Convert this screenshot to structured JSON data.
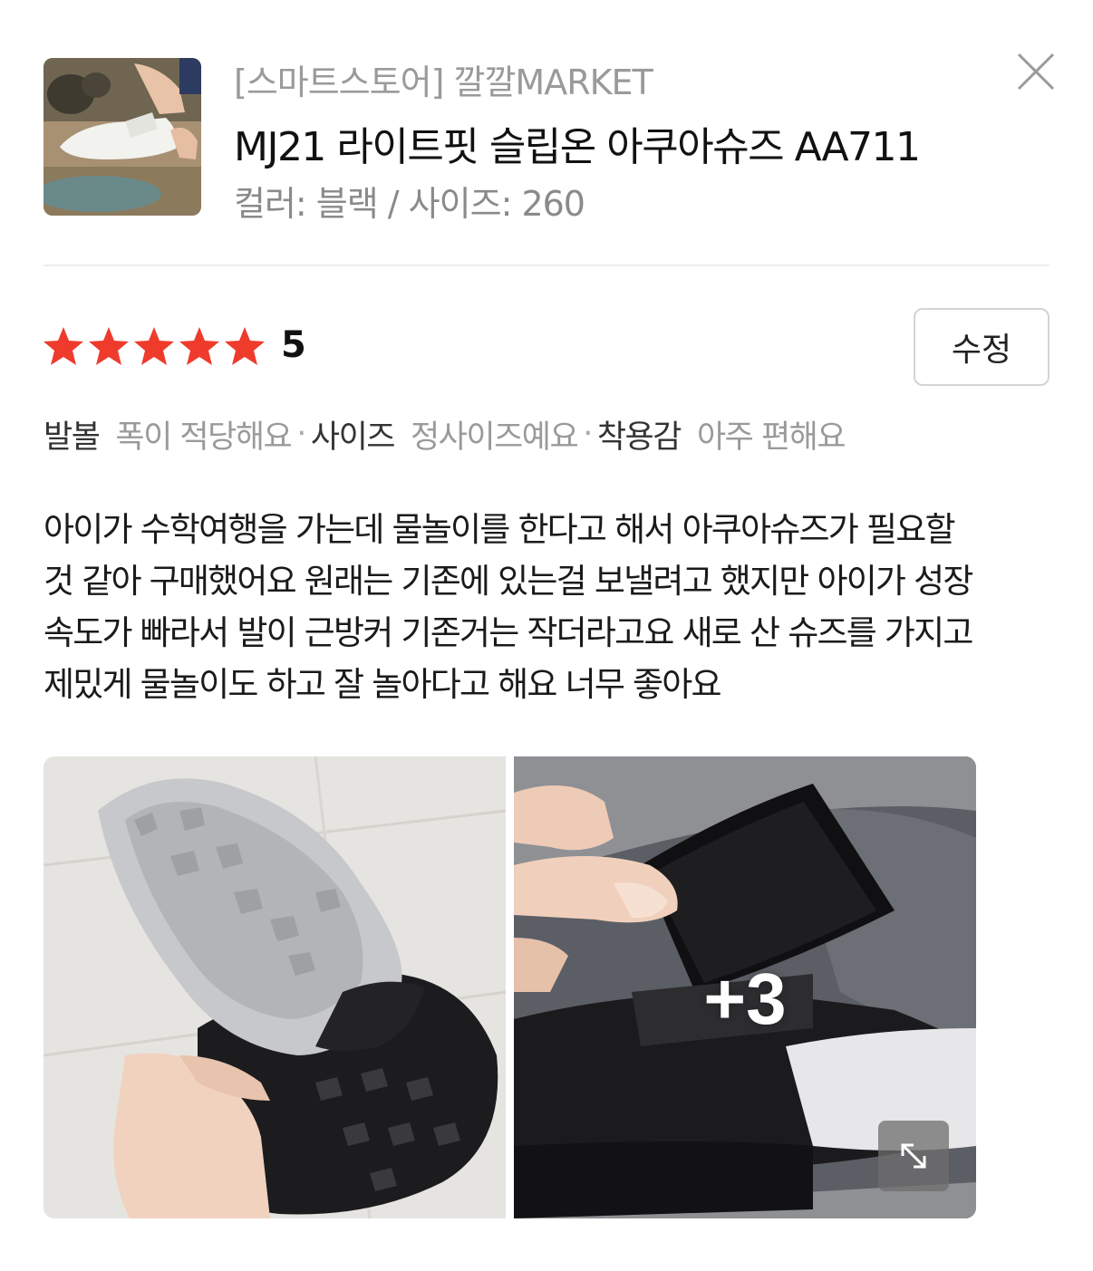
{
  "product": {
    "store": "[스마트스토어] 깔깔MARKET",
    "name": "MJ21 라이트핏 슬립온 아쿠아슈즈 AA711",
    "options": "컬러: 블랙 / 사이즈: 260"
  },
  "rating": {
    "score": "5",
    "stars": 5,
    "star_color": "#ef3b2c"
  },
  "edit_button": "수정",
  "attributes": [
    {
      "key": "발볼",
      "value": "폭이 적당해요"
    },
    {
      "key": "사이즈",
      "value": "정사이즈예요"
    },
    {
      "key": "착용감",
      "value": "아주 편해요"
    }
  ],
  "attribute_separator": "·",
  "review_lines": [
    "아이가 수학여행을 가는데 물놀이를 한다고 해서 아쿠아슈즈가 필요할",
    "것 같아 구매했어요 원래는 기존에 있는걸 보낼려고 했지만 아이가 성장",
    "속도가 빠라서 발이 근방커 기존거는 작더라고요 새로 산 슈즈를 가지고",
    "제밌게 물놀이도 하고 잘 놀아다고 해요 너무 좋아요"
  ],
  "photos": {
    "more_count": "+3",
    "icons": [
      "close-icon",
      "star-icon",
      "expand-icon"
    ]
  }
}
